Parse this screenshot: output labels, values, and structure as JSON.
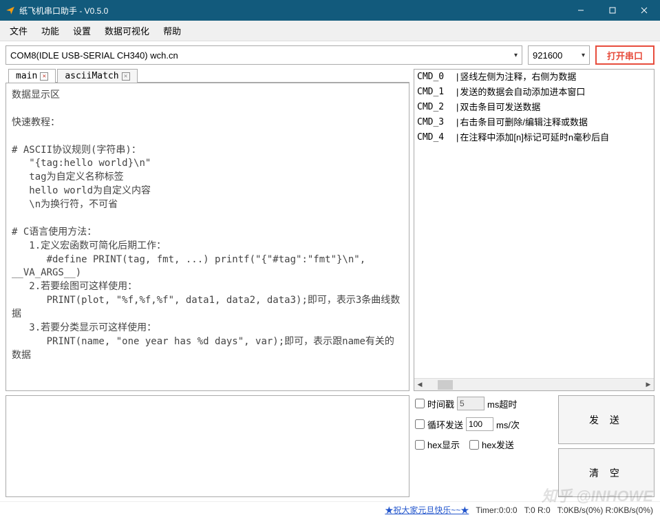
{
  "window": {
    "title": "纸飞机串口助手 - V0.5.0"
  },
  "menu": {
    "file": "文件",
    "func": "功能",
    "settings": "设置",
    "datavis": "数据可视化",
    "help": "帮助"
  },
  "toolbar": {
    "port": "COM8(IDLE  USB-SERIAL CH340) wch.cn",
    "baud": "921600",
    "open": "打开串口"
  },
  "tabs": {
    "main": "main",
    "ascii": "asciiMatch"
  },
  "display_text": "数据显示区\n\n快速教程：\n\n# ASCII协议规则(字符串)：\n   \"{tag:hello world}\\n\"\n   tag为自定义名称标签\n   hello world为自定义内容\n   \\n为换行符，不可省\n\n# C语言使用方法：\n   1.定义宏函数可简化后期工作：\n      #define PRINT(tag, fmt, ...) printf(\"{\"#tag\":\"fmt\"}\\n\", __VA_ARGS__)\n   2.若要绘图可这样使用：\n      PRINT(plot, \"%f,%f,%f\", data1, data2, data3);即可，表示3条曲线数据\n   3.若要分类显示可这样使用：\n      PRINT(name, \"one year has %d days\", var);即可，表示跟name有关的数据",
  "cmds": [
    {
      "id": "CMD_0",
      "txt": "竖线左侧为注释，右侧为数据"
    },
    {
      "id": "CMD_1",
      "txt": "发送的数据会自动添加进本窗口"
    },
    {
      "id": "CMD_2",
      "txt": "双击条目可发送数据"
    },
    {
      "id": "CMD_3",
      "txt": "右击条目可删除/编辑注释或数据"
    },
    {
      "id": "CMD_4",
      "txt": "在注释中添加[n]标记可延时n毫秒后自"
    }
  ],
  "options": {
    "timestamp_label": "时间戳",
    "timestamp_value": "5",
    "timestamp_unit": "ms超时",
    "loop_label": "循环发送",
    "loop_value": "100",
    "loop_unit": "ms/次",
    "hex_display": "hex显示",
    "hex_send": "hex发送"
  },
  "buttons": {
    "send": "发 送",
    "clear": "清 空"
  },
  "status": {
    "greet": "★祝大家元旦快乐~~★",
    "timer": "Timer:0:0:0",
    "tr": "T:0 R:0",
    "kb": "T:0KB/s(0%) R:0KB/s(0%)"
  },
  "watermark": "知乎 @INHOWE"
}
